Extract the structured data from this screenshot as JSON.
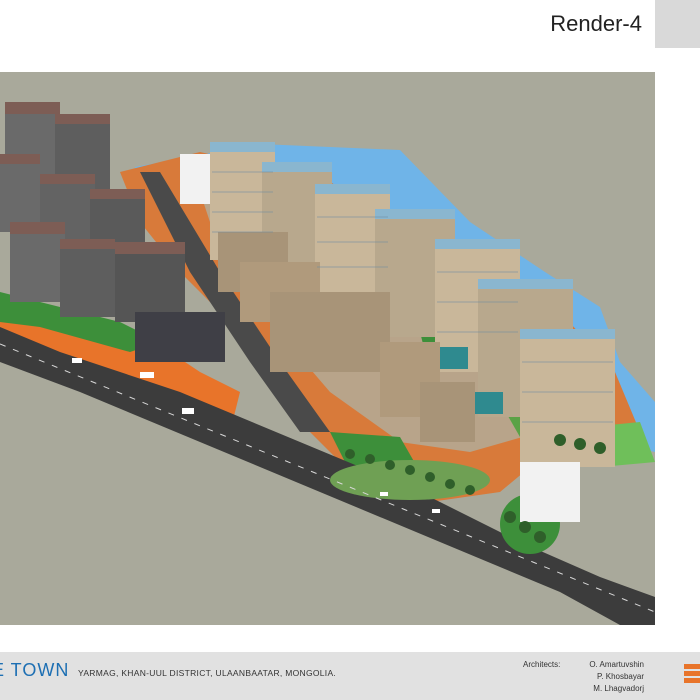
{
  "header": {
    "title": "Render-4"
  },
  "footer": {
    "project_name": "E TOWN",
    "location": "YARMAG, KHAN-UUL DISTRICT, ULAANBAATAR, MONGOLIA.",
    "architects_label": "Architects:",
    "architects": [
      "O. Amartuvshin",
      "P. Khosbayar",
      "M. Lhagvadorj"
    ]
  },
  "colors": {
    "background": "#a9a99b",
    "water": "#6fb4e8",
    "road": "#3c3c3c",
    "grass": "#3d8f3a",
    "accent_orange": "#e8742a",
    "tower": "#c9b79a",
    "tower_roof": "#8ab6cf",
    "brand_blue": "#1d6fb3",
    "logo_orange": "#e8742a"
  }
}
